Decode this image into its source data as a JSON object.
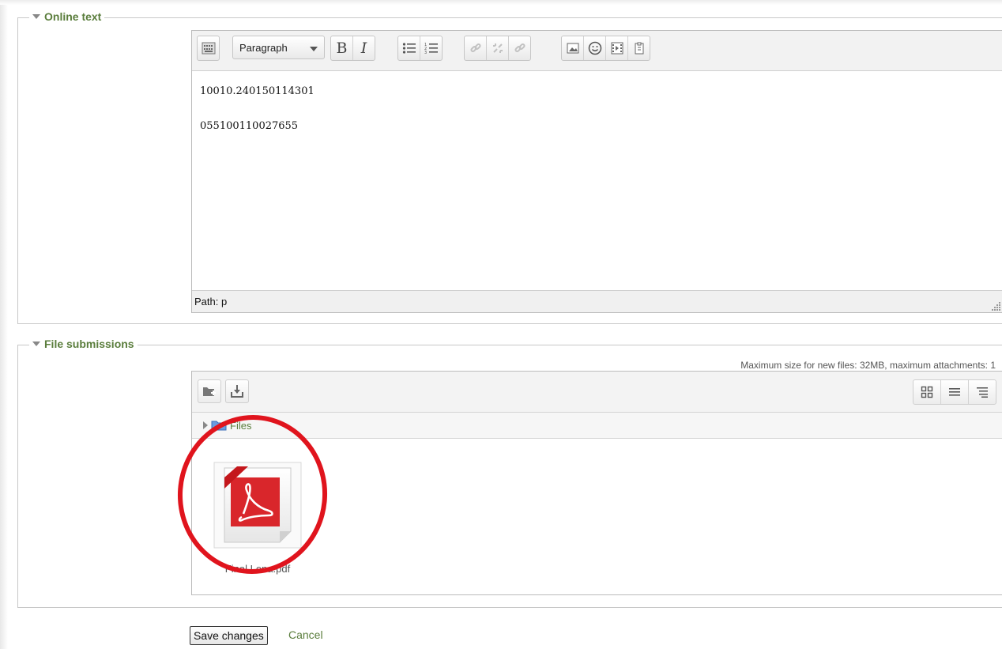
{
  "online_text": {
    "legend": "Online text",
    "format_select": "Paragraph",
    "lines": [
      "10010.240150114301",
      "055100110027655"
    ],
    "path_label": "Path: p",
    "toolbar_icons": [
      "toggle-toolbar-icon",
      "bold-icon",
      "italic-icon",
      "bullet-list-icon",
      "numbered-list-icon",
      "link-icon",
      "unlink-icon",
      "anchor-icon",
      "image-icon",
      "emoticon-icon",
      "media-icon",
      "paste-word-icon"
    ]
  },
  "file_submissions": {
    "legend": "File submissions",
    "max_info": "Maximum size for new files: 32MB, maximum attachments: 1",
    "breadcrumb": "Files",
    "file_name": "Final Lena.pdf"
  },
  "actions": {
    "save_label": "Save changes",
    "cancel_label": "Cancel"
  },
  "annotation": {
    "color": "#e0141d",
    "shape": "hand-drawn circle"
  }
}
